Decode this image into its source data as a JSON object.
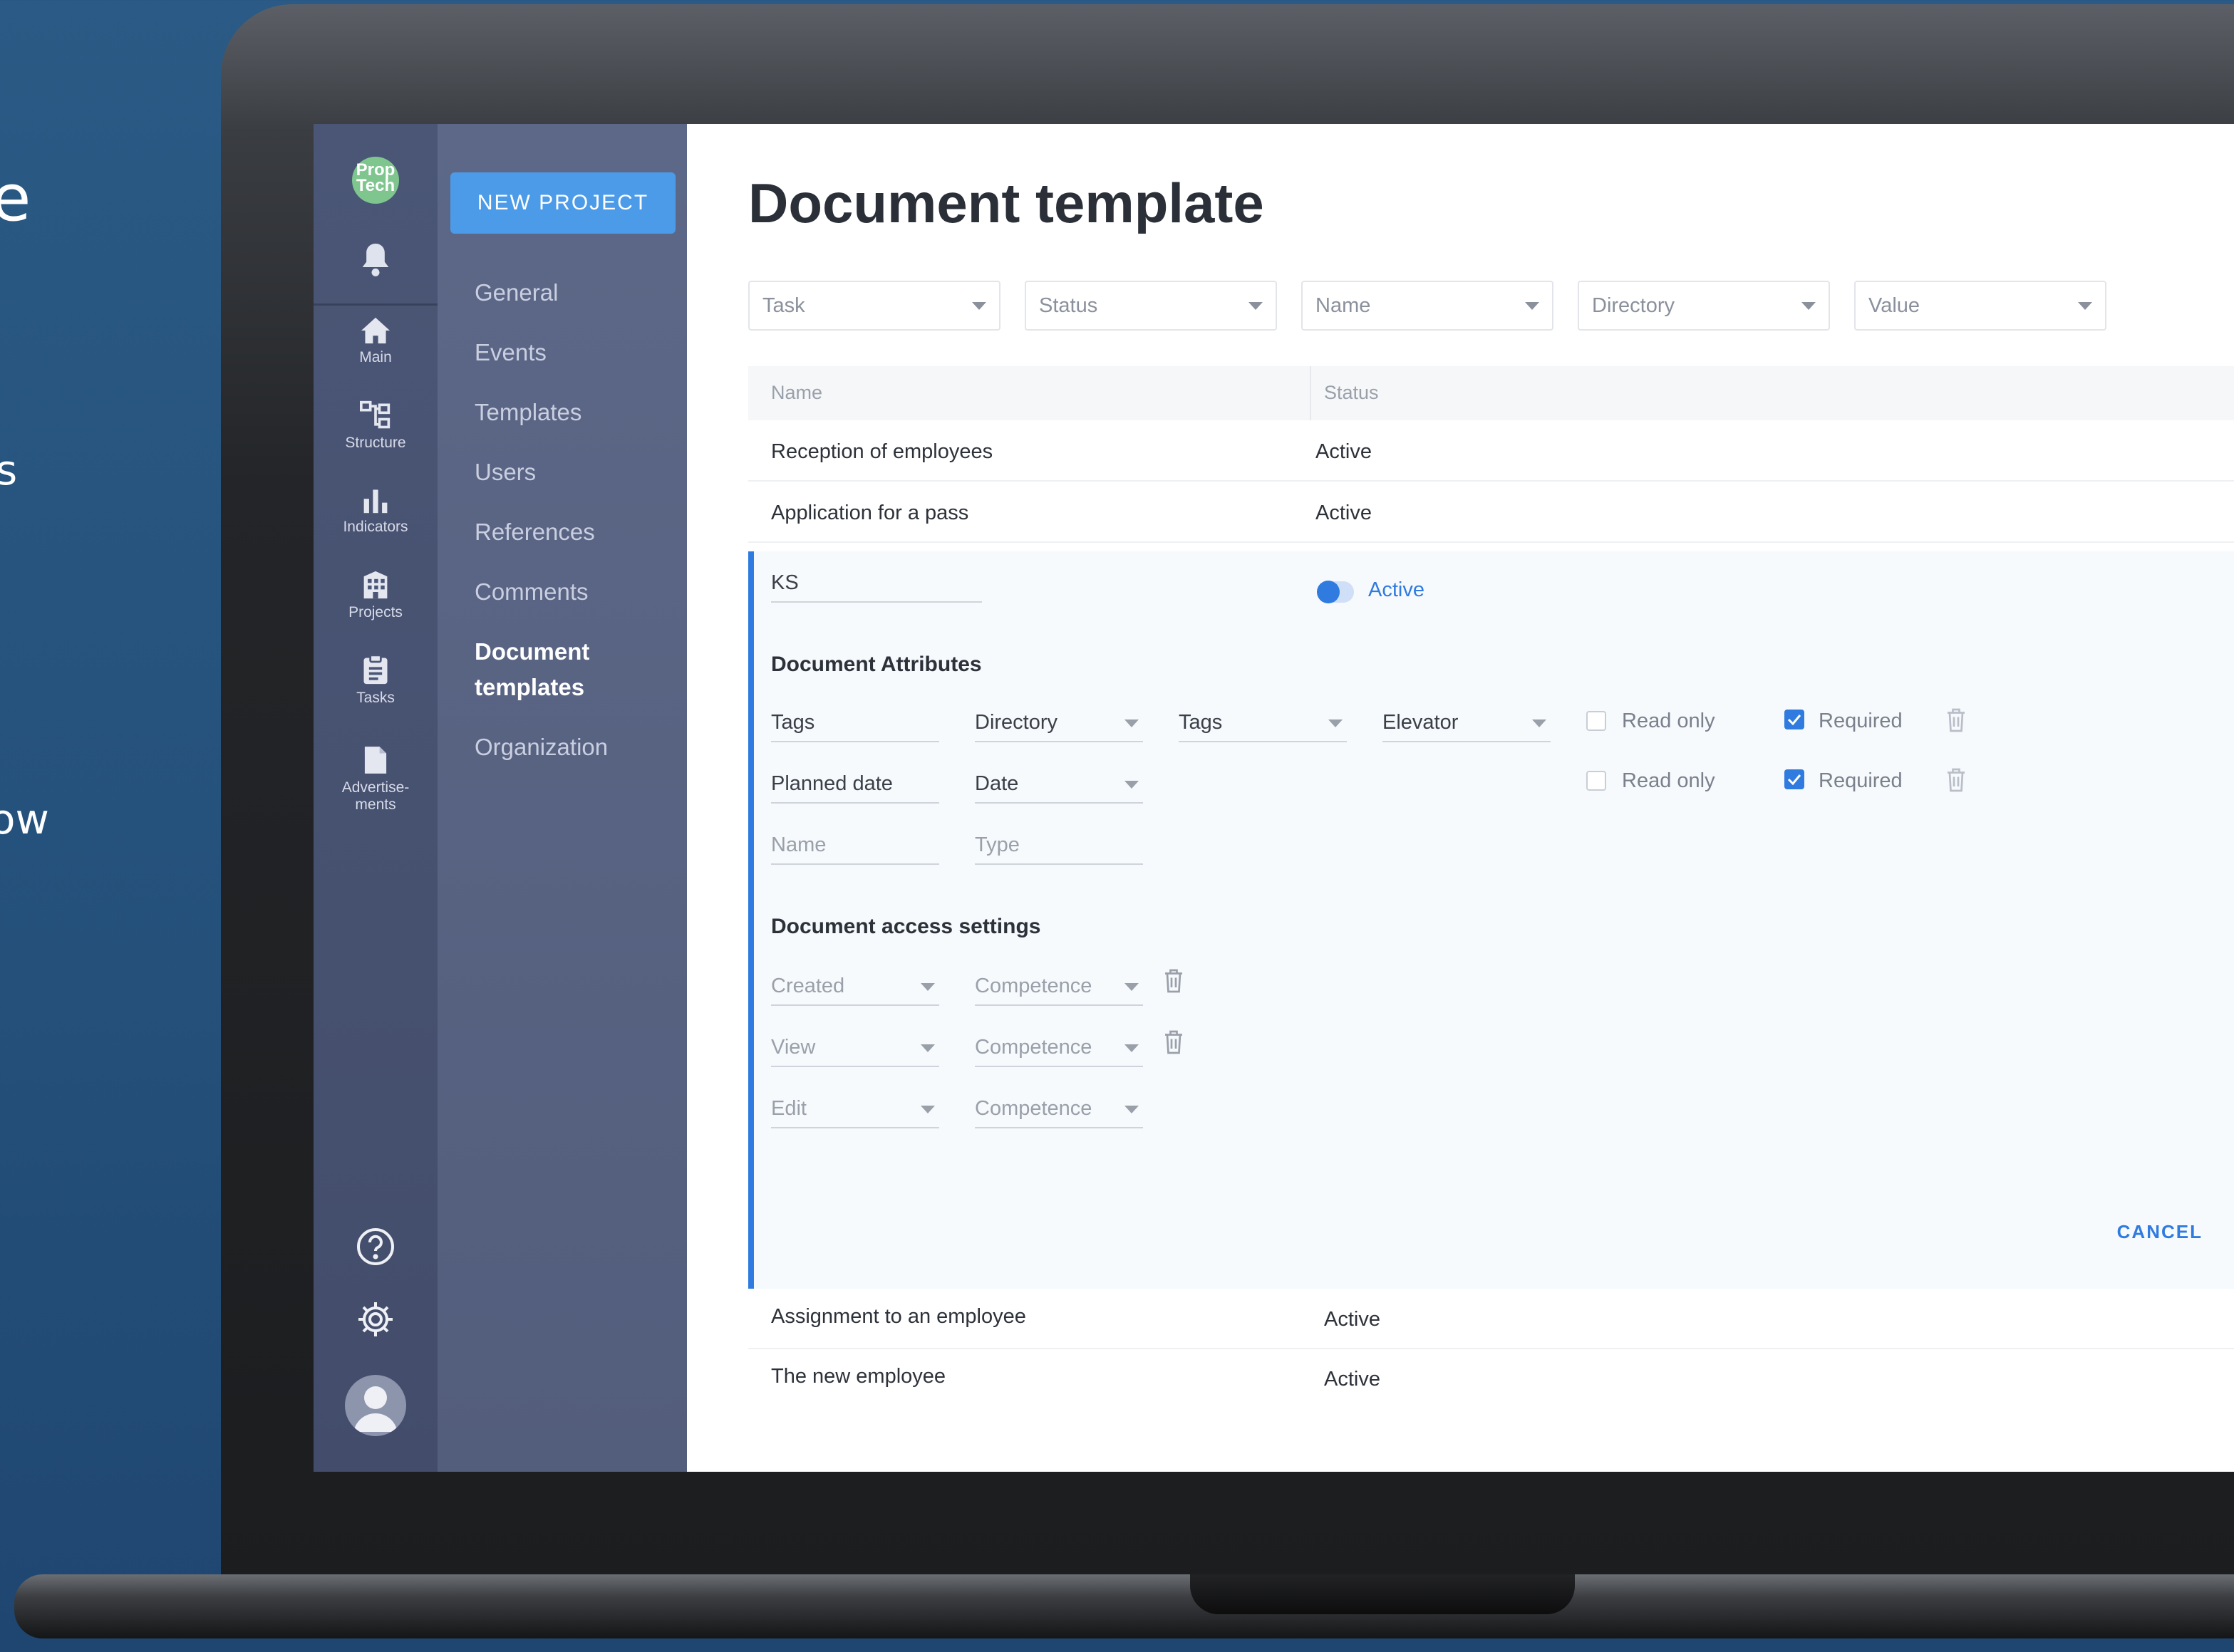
{
  "background_fragments": [
    "e",
    "s",
    "ow"
  ],
  "rail": {
    "logo_text_line1": "Prop",
    "logo_text_line2": "Tech",
    "items": [
      {
        "label": "Main",
        "icon": "home-icon"
      },
      {
        "label": "Structure",
        "icon": "structure-icon"
      },
      {
        "label": "Indicators",
        "icon": "bar-chart-icon"
      },
      {
        "label": "Projects",
        "icon": "building-icon"
      },
      {
        "label": "Tasks",
        "icon": "clipboard-icon"
      },
      {
        "label_line1": "Advertise-",
        "label_line2": "ments",
        "icon": "document-icon"
      }
    ]
  },
  "nav": {
    "new_project": "NEW PROJECT",
    "items": [
      "General",
      "Events",
      "Templates",
      "Users",
      "References",
      "Comments"
    ],
    "active_line1": "Document",
    "active_line2": "templates",
    "last": "Organization"
  },
  "main": {
    "title": "Document template",
    "filters": [
      "Task",
      "Status",
      "Name",
      "Directory",
      "Value"
    ],
    "columns": {
      "name": "Name",
      "status": "Status"
    },
    "rows_top": [
      {
        "name": "Reception of employees",
        "status": "Active"
      },
      {
        "name": "Application for a pass",
        "status": "Active"
      }
    ],
    "editor": {
      "name_value": "KS",
      "status_label": "Active",
      "attributes_title": "Document Attributes",
      "attr_rows": [
        {
          "name": "Tags",
          "type": "Directory",
          "directory": "Tags",
          "value": "Elevator",
          "read_only": "Read only",
          "required": "Required"
        },
        {
          "name": "Planned date",
          "type": "Date",
          "read_only": "Read only",
          "required": "Required"
        }
      ],
      "new_attr": {
        "name_placeholder": "Name",
        "type_placeholder": "Type"
      },
      "access_title": "Document access settings",
      "access_rows": [
        {
          "action": "Created",
          "role": "Competence"
        },
        {
          "action": "View",
          "role": "Competence"
        },
        {
          "action": "Edit",
          "role": "Competence"
        }
      ],
      "cancel": "CANCEL"
    },
    "rows_bottom": [
      {
        "name": "Assignment to an employee",
        "status": "Active"
      },
      {
        "name": "The new employee",
        "status": "Active"
      }
    ]
  },
  "colors": {
    "accent": "#2f7be0",
    "button": "#4c9be8",
    "rail": "#4b5676",
    "nav": "#5d6888"
  }
}
